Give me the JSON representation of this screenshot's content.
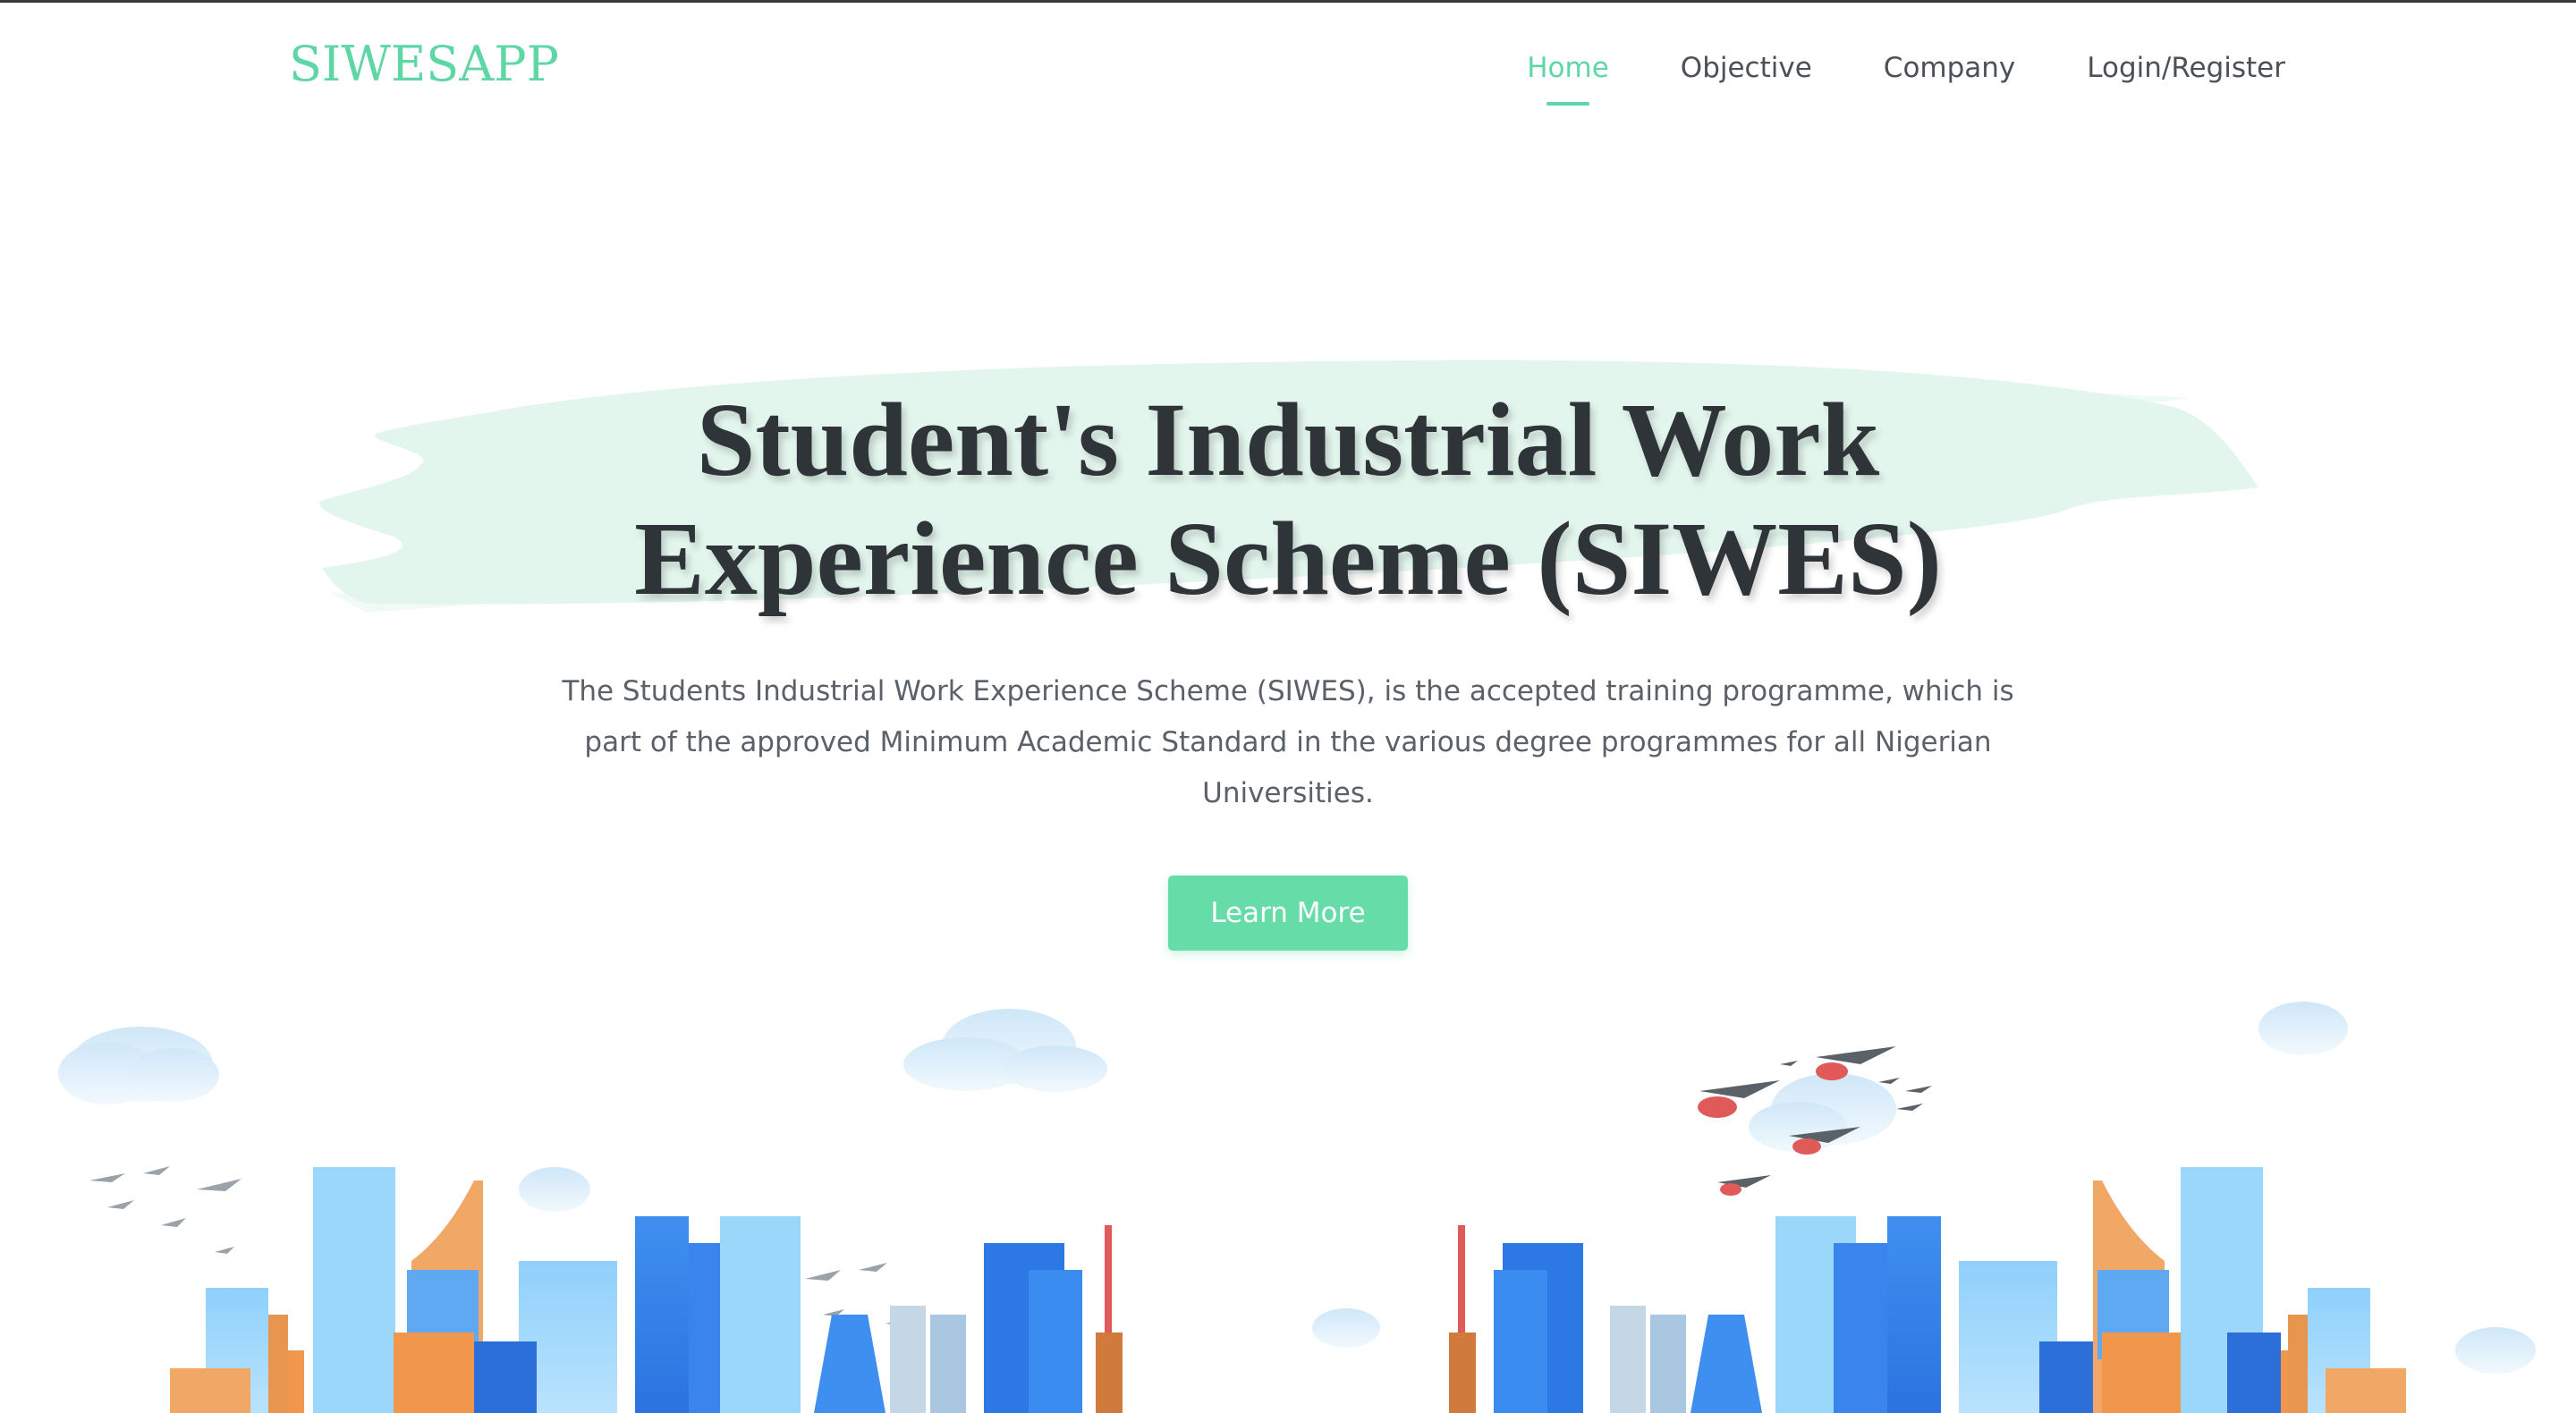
{
  "brand": {
    "logo_text": "SIWESAPP",
    "accent_color": "#5fd6a6",
    "button_color": "#66dca9",
    "brush_color": "#e3f6ee"
  },
  "nav": {
    "items": [
      {
        "label": "Home",
        "active": true
      },
      {
        "label": "Objective",
        "active": false
      },
      {
        "label": "Company",
        "active": false
      },
      {
        "label": "Login/Register",
        "active": false
      }
    ]
  },
  "hero": {
    "title_line1": "Student's Industrial Work",
    "title_line2": "Experience Scheme (SIWES)",
    "description": "The Students Industrial Work Experience Scheme (SIWES), is the accepted training programme, which is part of the approved Minimum Academic Standard in the various degree programmes for all Nigerian Universities.",
    "cta_label": "Learn More"
  },
  "illustration": {
    "icon": "city-skyline-illustration",
    "elements": [
      "clouds-icon",
      "birds-icon",
      "skyscrapers-icon",
      "tv-tower-icon"
    ]
  }
}
